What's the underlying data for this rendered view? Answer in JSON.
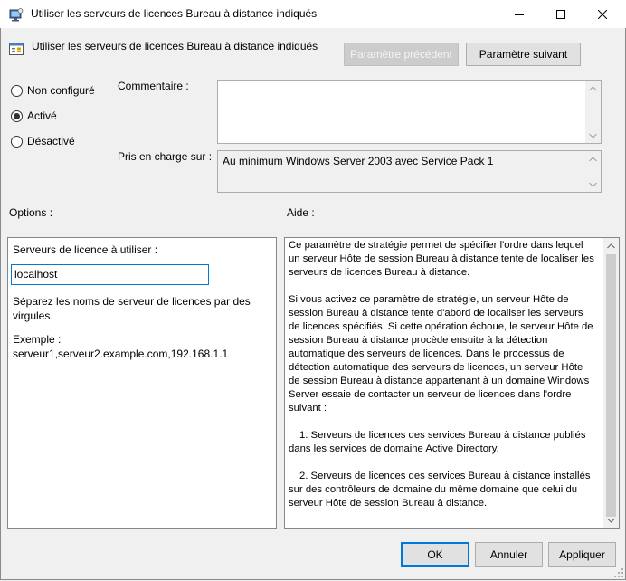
{
  "window": {
    "title": "Utiliser les serveurs de licences Bureau à distance indiqués",
    "controls": [
      "minimize-icon",
      "maximize-icon",
      "close-icon"
    ]
  },
  "header": {
    "setting_name": "Utiliser les serveurs de licences Bureau à distance indiqués",
    "prev_button": "Paramètre précédent",
    "next_button": "Paramètre suivant"
  },
  "state": {
    "options": [
      {
        "label": "Non configuré",
        "checked": false
      },
      {
        "label": "Activé",
        "checked": true
      },
      {
        "label": "Désactivé",
        "checked": false
      }
    ]
  },
  "comment": {
    "label": "Commentaire :",
    "value": ""
  },
  "supported": {
    "label": "Pris en charge sur :",
    "value": "Au minimum Windows Server 2003 avec Service Pack 1"
  },
  "options_section": {
    "title": "Options :",
    "servers_label": "Serveurs de licence à utiliser :",
    "servers_value": "localhost",
    "hint": "Séparez les noms de serveur de licences par des virgules.",
    "example_label": "Exemple :",
    "example_value": "serveur1,serveur2.example.com,192.168.1.1"
  },
  "help_section": {
    "title": "Aide :",
    "paragraphs": [
      "Ce paramètre de stratégie permet de spécifier l'ordre dans lequel un serveur Hôte de session Bureau à distance tente de localiser les serveurs de licences Bureau à distance.",
      "Si vous activez ce paramètre de stratégie, un serveur Hôte de session Bureau à distance tente d'abord de localiser les serveurs de licences spécifiés. Si cette opération échoue, le serveur Hôte de session Bureau à distance procède ensuite à la détection automatique des serveurs de licences. Dans le processus de détection automatique des serveurs de licences, un serveur Hôte de session Bureau à distance appartenant à un domaine Windows Server essaie de contacter un serveur de licences dans l'ordre suivant :",
      "1. Serveurs de licences des services Bureau à distance publiés dans les services de domaine Active Directory.",
      "2. Serveurs de licences des services Bureau à distance installés sur des contrôleurs de domaine du même domaine que celui du serveur Hôte de session Bureau à distance."
    ]
  },
  "footer": {
    "ok": "OK",
    "cancel": "Annuler",
    "apply": "Appliquer"
  },
  "colors": {
    "accent": "#0078d7",
    "window_bg": "#f0f0f0"
  }
}
